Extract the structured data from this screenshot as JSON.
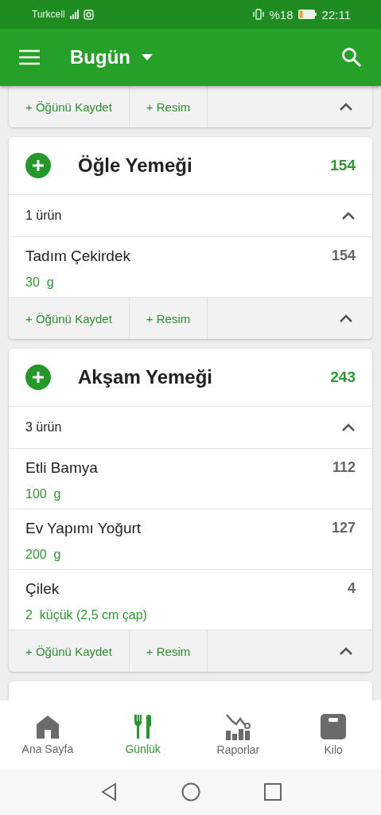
{
  "status_bar": {
    "carrier": "Turkcell",
    "battery": "%18",
    "time": "22:11"
  },
  "app_bar": {
    "title": "Bugün"
  },
  "top_card_footer": {
    "save": "+ Öğünü Kaydet",
    "photo": "+ Resim",
    "expanded": true
  },
  "meals": [
    {
      "title": "Öğle Yemeği",
      "calories": "154",
      "count": "1 ürün",
      "expanded": true,
      "items": [
        {
          "name": "Tadım Çekirdek",
          "amount": "30  g",
          "calories": "154"
        }
      ],
      "save": "+ Öğünü Kaydet",
      "photo": "+ Resim"
    },
    {
      "title": "Akşam Yemeği",
      "calories": "243",
      "count": "3 ürün",
      "expanded": true,
      "items": [
        {
          "name": "Etli Bamya",
          "amount": "100  g",
          "calories": "112"
        },
        {
          "name": "Ev Yapımı Yoğurt",
          "amount": "200  g",
          "calories": "127"
        },
        {
          "name": "Çilek",
          "amount": "2  küçük (2,5 cm çap)",
          "calories": "4"
        }
      ],
      "save": "+ Öğünü Kaydet",
      "photo": "+ Resim"
    }
  ],
  "bottom_nav": [
    {
      "label": "Ana Sayfa",
      "kind": "home",
      "selected": false
    },
    {
      "label": "Günlük",
      "kind": "diary",
      "selected": true
    },
    {
      "label": "Raporlar",
      "kind": "reports",
      "selected": false
    },
    {
      "label": "Kilo",
      "kind": "scale",
      "selected": false
    }
  ]
}
